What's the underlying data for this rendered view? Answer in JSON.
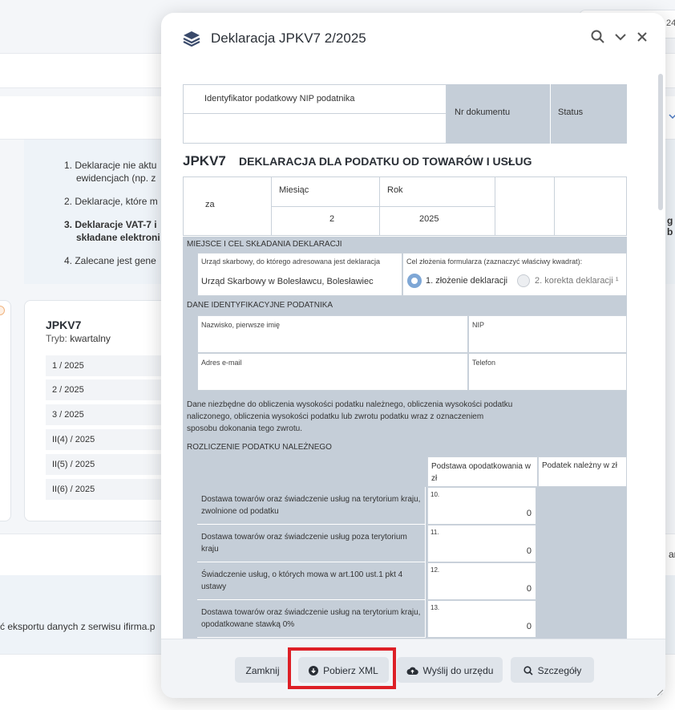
{
  "background": {
    "top_right_text": "24",
    "info_list": [
      "1. Deklaracje nie aktu",
      "ewidencjach (np. z",
      "2. Deklaracje, które m",
      "3. Deklaracje VAT-7 i",
      "składane elektroni",
      "4. Zalecane jest gene"
    ],
    "card": {
      "title": "JPKV7",
      "mode_label": "Tryb:",
      "mode_value": "kwartalny",
      "periods": [
        "1 / 2025",
        "2 / 2025",
        "3 / 2025",
        "II(4) / 2025",
        "II(5) / 2025",
        "II(6) / 2025"
      ]
    },
    "bottom_text": "ć eksportu danych z serwisu ifirma.p",
    "right_fragment_1": "g b",
    "right_fragment_2": "ar"
  },
  "modal": {
    "title": "Deklaracja JPKV7 2/2025",
    "doc": {
      "nip_label": "Identyfikator podatkowy NIP podatnika",
      "doc_number_label": "Nr dokumentu",
      "status_label": "Status",
      "form_code": "JPKV7",
      "form_title": "DEKLARACJA DLA PODATKU OD TOWARÓW I USŁUG",
      "za_label": "za",
      "month_label": "Miesiąc",
      "year_label": "Rok",
      "month_value": "2",
      "year_value": "2025",
      "section_place": "MIEJSCE I CEL SKŁADANIA DEKLARACJI",
      "office_label": "Urząd skarbowy, do którego adresowana jest deklaracja",
      "office_value": "Urząd Skarbowy w Bolesławcu, Bolesławiec",
      "purpose_label": "Cel złożenia formularza (zaznaczyć właściwy kwadrat):",
      "purpose_option1": "1. złożenie deklaracji",
      "purpose_option2": "2. korekta deklaracji ¹",
      "section_identity": "DANE IDENTYFIKACYJNE PODATNIKA",
      "name_label": "Nazwisko, pierwsze imię",
      "nip_field_label": "NIP",
      "email_label": "Adres e-mail",
      "phone_label": "Telefon",
      "calc_note": [
        "Dane niezbędne do obliczenia wysokości podatku należnego, obliczenia wysokości podatku",
        "naliczonego, obliczenia wysokości podatku lub zwrotu podatku wraz z oznaczeniem",
        "sposobu dokonania tego zwrotu."
      ],
      "section_tax": "ROZLICZENIE PODATKU NALEŻNEGO",
      "col_base": "Podstawa opodatkowania w zł",
      "col_tax": "Podatek należny w zł",
      "rows": [
        {
          "label": "Dostawa towarów oraz świadczenie usług na terytorium kraju, zwolnione od podatku",
          "num": "10.",
          "value": "0"
        },
        {
          "label": "Dostawa towarów oraz świadczenie usług poza terytorium kraju",
          "num": "11.",
          "value": "0"
        },
        {
          "label": "Świadczenie usług, o których mowa w art.100 ust.1 pkt 4 ustawy",
          "num": "12.",
          "value": "0"
        },
        {
          "label": "Dostawa towarów oraz świadczenie usług na terytorium kraju, opodatkowane stawką 0%",
          "num": "13.",
          "value": "0"
        }
      ]
    },
    "footer": {
      "close": "Zamknij",
      "download": "Pobierz XML",
      "send": "Wyślij do urzędu",
      "details": "Szczegóły"
    }
  }
}
